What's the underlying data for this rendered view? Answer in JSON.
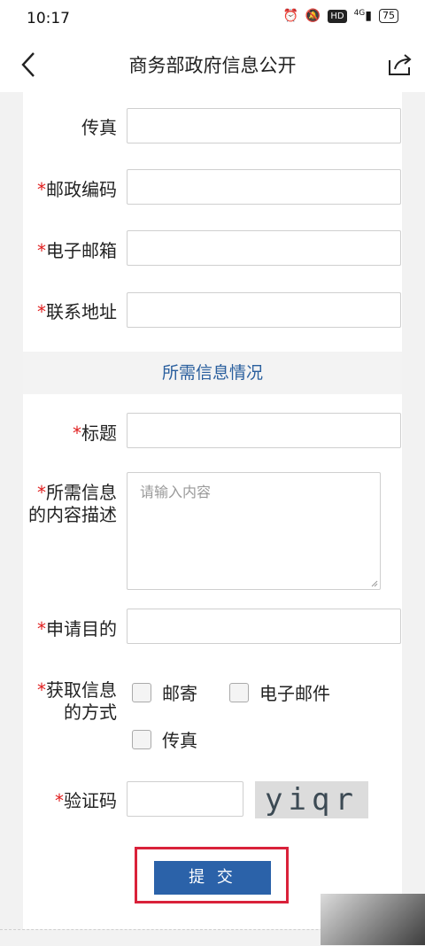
{
  "status": {
    "time": "10:17",
    "signal": "4G",
    "battery": "75"
  },
  "header": {
    "title": "商务部政府信息公开"
  },
  "form": {
    "fax_label": "传真",
    "postal_label": "邮政编码",
    "email_label": "电子邮箱",
    "address_label": "联系地址",
    "section_title": "所需信息情况",
    "title_label": "标题",
    "desc_label_line1": "所需信息",
    "desc_label_line2": "的内容描述",
    "desc_placeholder": "请输入内容",
    "purpose_label": "申请目的",
    "method_label_line1": "获取信息",
    "method_label_line2": "的方式",
    "method_options": [
      "邮寄",
      "电子邮件",
      "传真"
    ],
    "captcha_label": "验证码",
    "captcha_text": "yiqr",
    "submit_label": "提 交",
    "required_mark": "*"
  }
}
